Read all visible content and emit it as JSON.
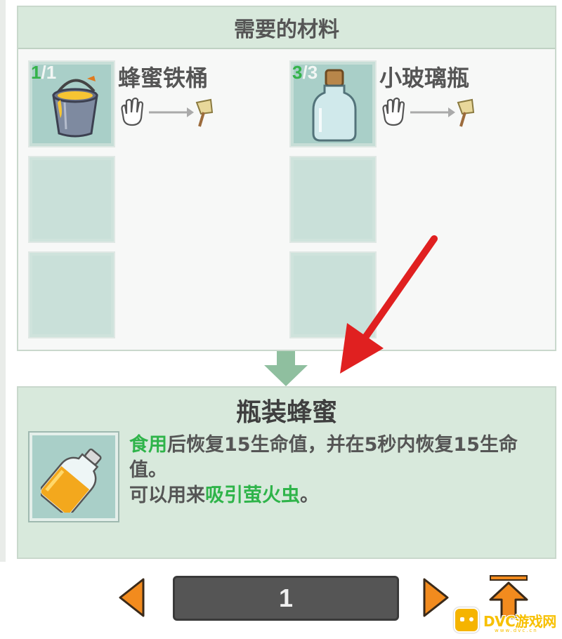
{
  "materials": {
    "header": "需要的材料",
    "items": [
      {
        "name": "蜂蜜铁桶",
        "have": "1",
        "need": "1",
        "icon": "honey-bucket-icon"
      },
      {
        "name": "小玻璃瓶",
        "have": "3",
        "need": "3",
        "icon": "glass-bottle-icon"
      }
    ]
  },
  "result": {
    "title": "瓶装蜂蜜",
    "icon": "bottled-honey-icon",
    "desc_kw1": "食用",
    "desc_part1": "后恢复15生命值，并在5秒内恢复15生命值。",
    "desc_part2": "可以用来",
    "desc_kw2": "吸引萤火虫",
    "desc_part3": "。"
  },
  "pager": {
    "page": "1"
  },
  "watermark": {
    "text": "DVC游戏网",
    "sub": "www.dvc.cn"
  },
  "colors": {
    "keyword": "#2fb44a",
    "panel": "#d8e9dc",
    "slot": "#a9cfc8",
    "nav_arrow": "#f28b1e",
    "annotation": "#e02020"
  }
}
